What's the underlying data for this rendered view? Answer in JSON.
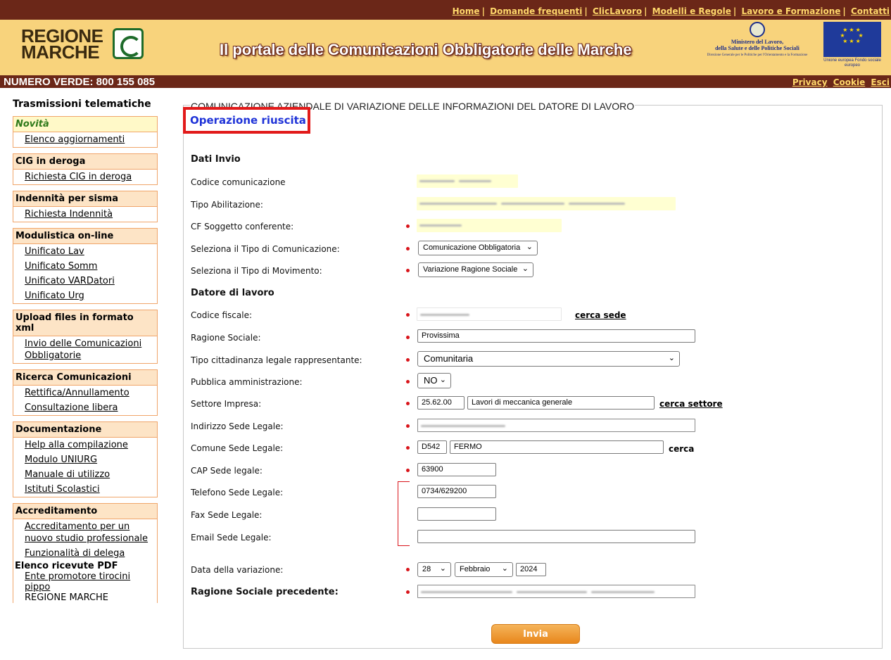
{
  "header": {
    "top_links": [
      "Home",
      "Domande frequenti",
      "ClicLavoro",
      "Modelli e Regole",
      "Lavoro e Formazione",
      "Contatti"
    ],
    "logo_text": "REGIONE\nMARCHE",
    "portal_title": "Il portale delle Comunicazioni Obbligatorie delle Marche",
    "ministry_line1": "Ministero del Lavoro,",
    "ministry_line2": "della Salute e delle Politiche Sociali",
    "ministry_line3": "Direzione Generale per le Politiche per l'Orientamento e la Formazione",
    "eu_caption": "Unione europea Fondo sociale europeo",
    "numero_verde": "NUMERO VERDE: 800 155 085",
    "privacy_links": [
      "Privacy",
      "Cookie",
      "Esci"
    ]
  },
  "sidebar": {
    "title": "Trasmissioni telematiche",
    "groups": [
      {
        "head": "Novità",
        "items": [
          "Elenco aggiornamenti"
        ]
      },
      {
        "head": "CIG in deroga",
        "items": [
          "Richiesta CIG in deroga"
        ]
      },
      {
        "head": "Indennità per sisma",
        "items": [
          "Richiesta Indennità"
        ]
      },
      {
        "head": "Modulistica on-line",
        "items": [
          "Unificato Lav",
          "Unificato Somm",
          "Unificato VARDatori",
          "Unificato Urg"
        ]
      },
      {
        "head": "Upload files in formato xml",
        "items": [
          "Invio delle Comunicazioni Obbligatorie"
        ]
      },
      {
        "head": "Ricerca Comunicazioni",
        "items": [
          "Rettifica/Annullamento",
          "Consultazione libera"
        ]
      },
      {
        "head": "Documentazione",
        "items": [
          "Help alla compilazione",
          "Modulo UNIURG",
          "Manuale di utilizzo",
          "Istituti Scolastici"
        ]
      },
      {
        "head": "Accreditamento",
        "items": [
          "Accreditamento per un nuovo studio professionale",
          "Funzionalità di delega"
        ]
      }
    ],
    "pdf": {
      "head": "Elenco ricevute PDF",
      "link1": "Ente promotore tirocini",
      "link2": "pippo",
      "text3": "REGIONE MARCHE"
    }
  },
  "form": {
    "legend": "COMUNICAZIONE AZIENDALE DI VARIAZIONE DELLE INFORMAZIONI DEL DATORE DI LAVORO",
    "success": "Operazione riuscita",
    "section_invio": "Dati Invio",
    "codice_comunicazione": "Codice comunicazione",
    "tipo_abilitazione": "Tipo Abilitazione:",
    "cf_soggetto": "CF Soggetto conferente:",
    "tipo_comunicazione_label": "Seleziona il Tipo di Comunicazione:",
    "tipo_comunicazione_value": "Comunicazione Obbligatoria",
    "tipo_movimento_label": "Seleziona il Tipo di Movimento:",
    "tipo_movimento_value": "Variazione Ragione Sociale",
    "section_datore": "Datore di lavoro",
    "codice_fiscale": "Codice fiscale:",
    "cerca_sede": "cerca sede",
    "ragione_sociale_label": "Ragione Sociale:",
    "ragione_sociale_value": "Provissima",
    "cittadinanza_label": "Tipo cittadinanza legale rappresentante:",
    "cittadinanza_value": "Comunitaria",
    "pa_label": "Pubblica amministrazione:",
    "pa_value": "NO",
    "settore_label": "Settore Impresa:",
    "settore_code": "25.62.00",
    "settore_desc": "Lavori di meccanica generale",
    "cerca_settore": "cerca settore",
    "indirizzo_label": "Indirizzo Sede Legale:",
    "comune_label": "Comune Sede Legale:",
    "comune_code": "D542",
    "comune_name": "FERMO",
    "cerca": "cerca",
    "cap_label": "CAP Sede legale:",
    "cap_value": "63900",
    "telefono_label": "Telefono Sede Legale:",
    "telefono_value": "0734/629200",
    "fax_label": "Fax Sede Legale:",
    "fax_value": "",
    "email_label": "Email Sede Legale:",
    "email_value": "",
    "data_label": "Data della variazione:",
    "data_day": "28",
    "data_month": "Febbraio",
    "data_year": "2024",
    "ragione_prec_label": "Ragione Sociale precedente:",
    "submit": "Invia"
  },
  "colors": {
    "header_brown": "#6b2718",
    "header_gold": "#f8d37c",
    "success_blue": "#1f33d8",
    "highlight_red": "#e21a1a",
    "button_orange": "#e8871c"
  }
}
